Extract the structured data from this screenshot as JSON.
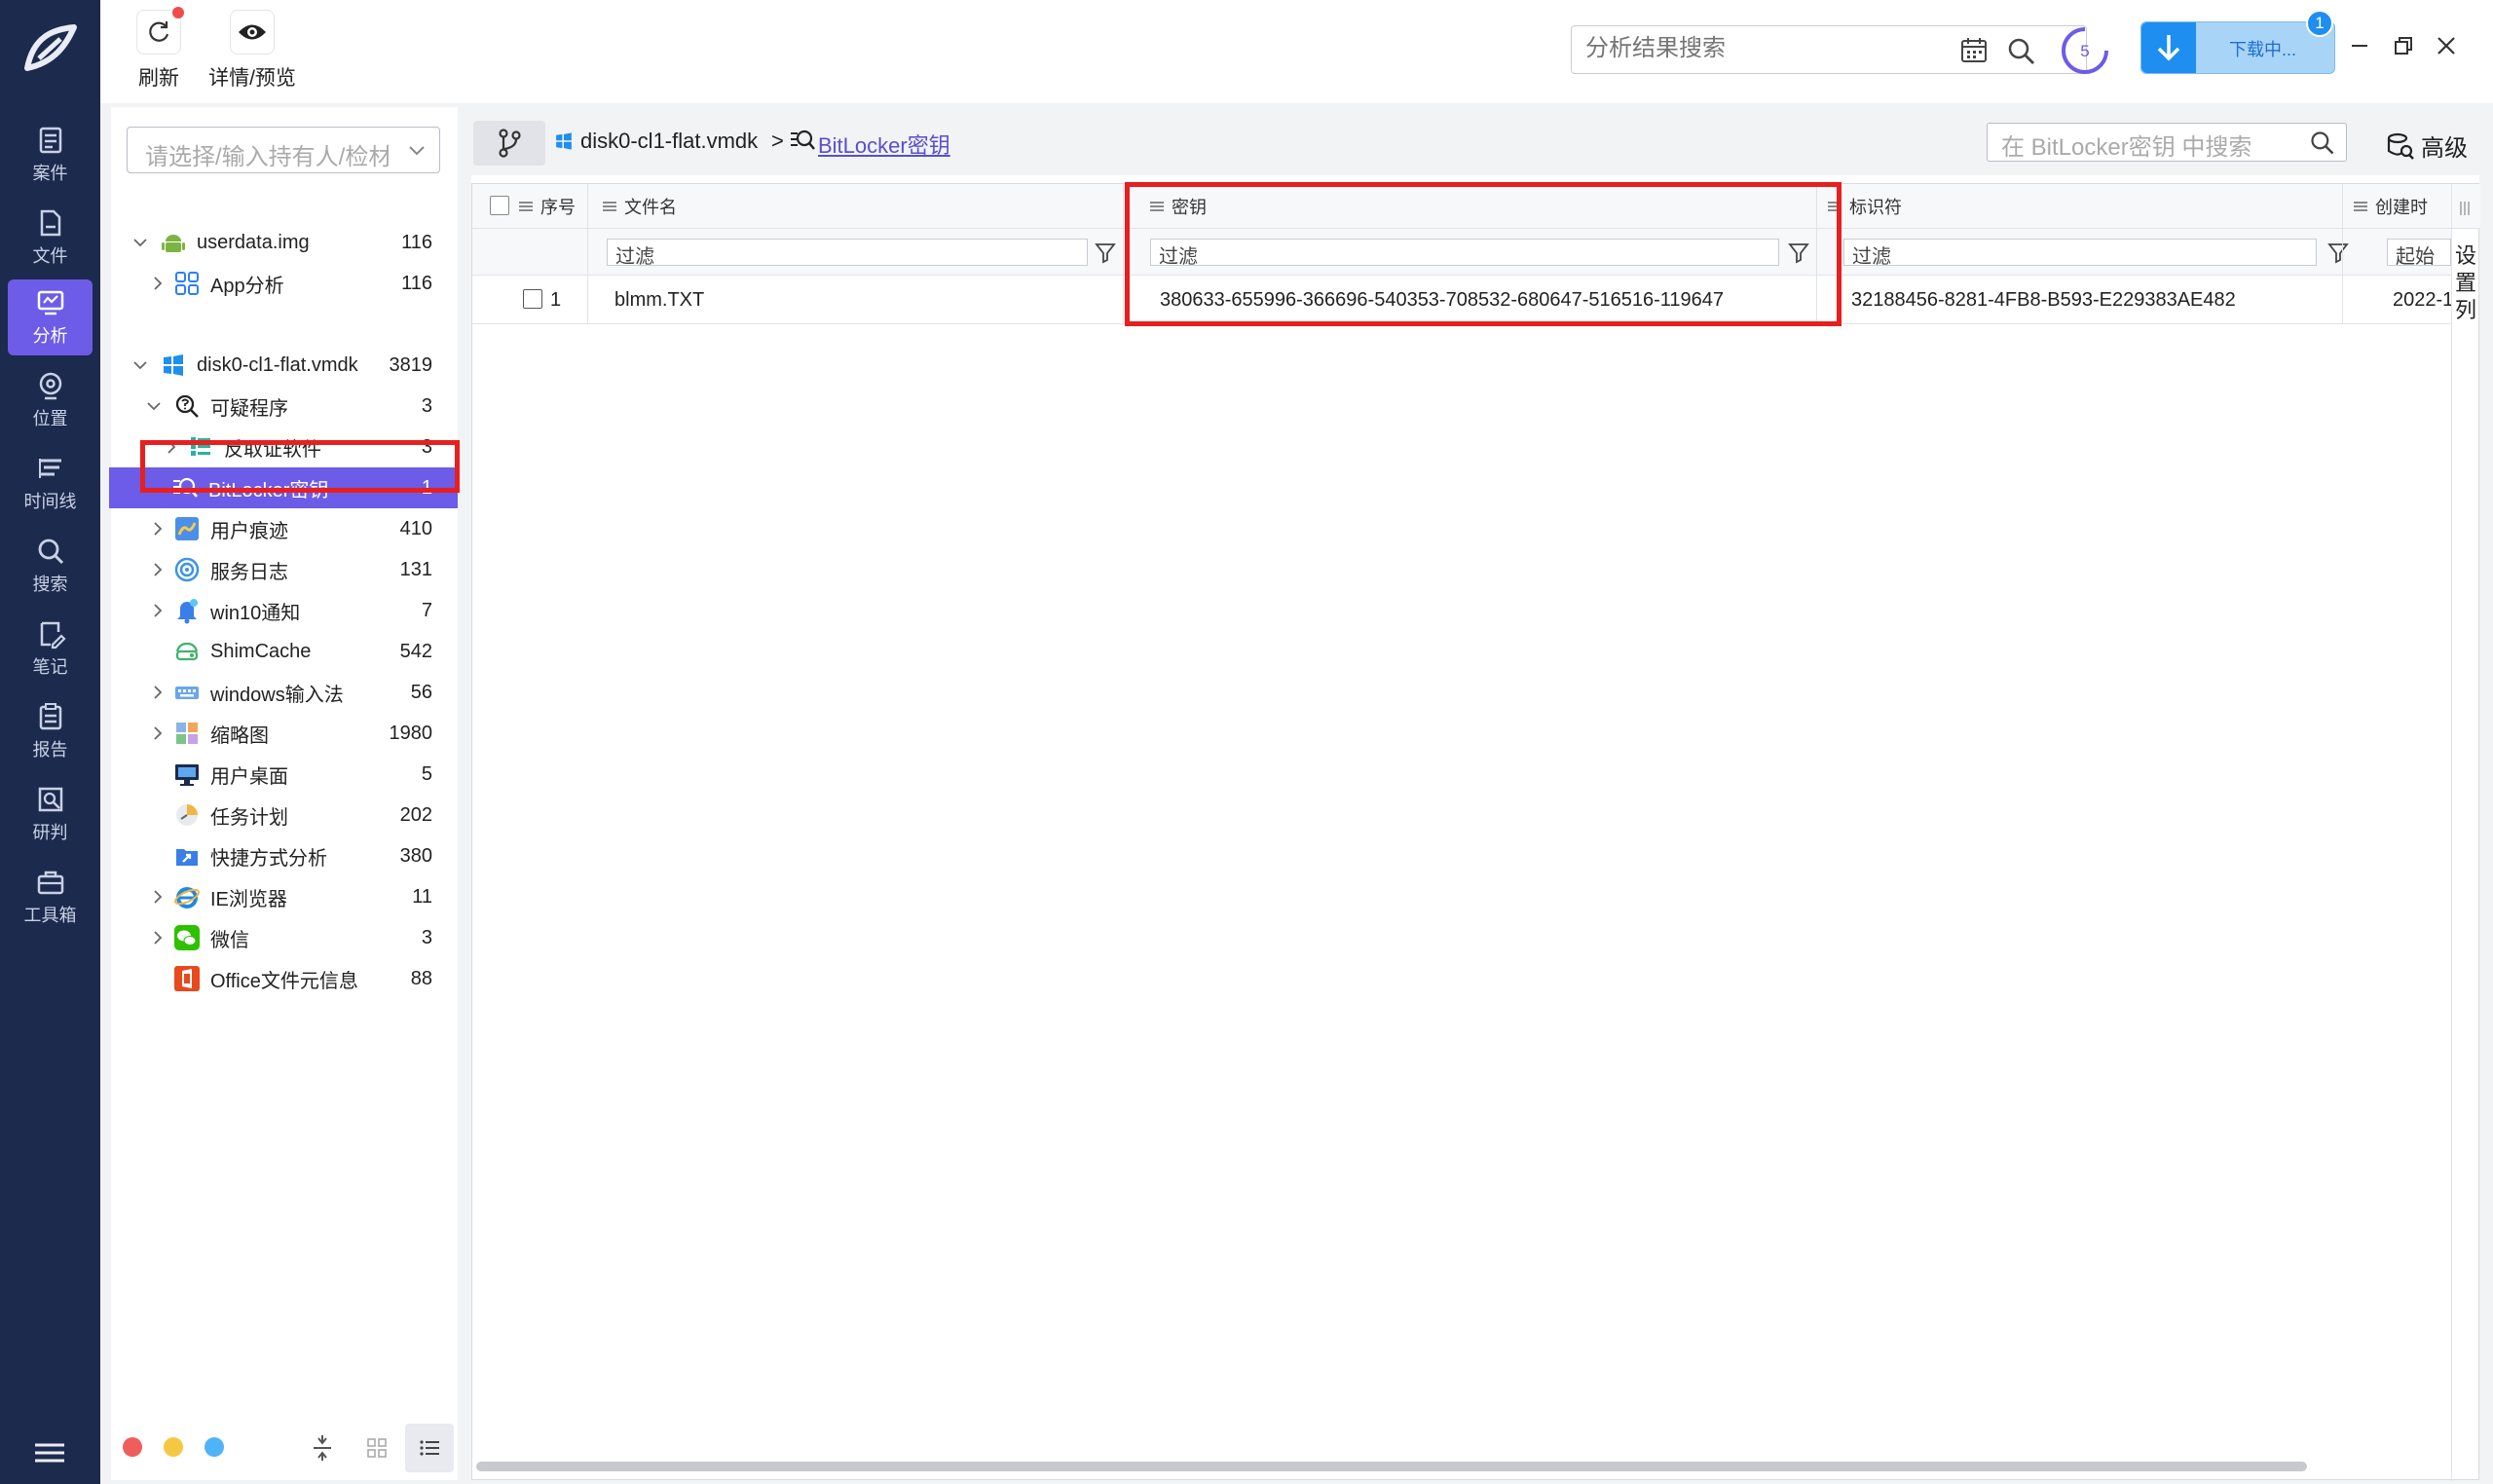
{
  "nav": {
    "items": [
      {
        "key": "case",
        "label": "案件",
        "icon": "case-icon"
      },
      {
        "key": "file",
        "label": "文件",
        "icon": "file-icon"
      },
      {
        "key": "analysis",
        "label": "分析",
        "icon": "analysis-icon",
        "active": true
      },
      {
        "key": "location",
        "label": "位置",
        "icon": "location-icon"
      },
      {
        "key": "timeline",
        "label": "时间线",
        "icon": "timeline-icon"
      },
      {
        "key": "search",
        "label": "搜索",
        "icon": "search-icon"
      },
      {
        "key": "notes",
        "label": "笔记",
        "icon": "notes-icon"
      },
      {
        "key": "report",
        "label": "报告",
        "icon": "report-icon"
      },
      {
        "key": "judge",
        "label": "研判",
        "icon": "judge-icon"
      },
      {
        "key": "toolbox",
        "label": "工具箱",
        "icon": "toolbox-icon"
      }
    ]
  },
  "toolbar": {
    "refresh_label": "刷新",
    "preview_label": "详情/预览",
    "search_placeholder": "分析结果搜索",
    "task_count": "5",
    "download_label": "下载中...",
    "download_badge": "1"
  },
  "tree": {
    "holder_placeholder": "请选择/输入持有人/检材",
    "nodes": [
      {
        "label": "userdata.img",
        "count": "116",
        "icon": "android-icon"
      },
      {
        "label": "App分析",
        "count": "116",
        "icon": "app-grid-icon"
      },
      {
        "label": "disk0-cl1-flat.vmdk",
        "count": "3819",
        "icon": "windows-icon"
      },
      {
        "label": "可疑程序",
        "count": "3",
        "icon": "suspicious-search-icon"
      },
      {
        "label": "反取证软件",
        "count": "3",
        "icon": "anti-forensics-icon"
      },
      {
        "label": "BitLocker密钥",
        "count": "1",
        "icon": "bitlocker-key-icon"
      },
      {
        "label": "用户痕迹",
        "count": "410",
        "icon": "user-trace-icon"
      },
      {
        "label": "服务日志",
        "count": "131",
        "icon": "service-log-icon"
      },
      {
        "label": "win10通知",
        "count": "7",
        "icon": "notification-bell-icon"
      },
      {
        "label": "ShimCache",
        "count": "542",
        "icon": "shimcache-icon"
      },
      {
        "label": "windows输入法",
        "count": "56",
        "icon": "keyboard-icon"
      },
      {
        "label": "缩略图",
        "count": "1980",
        "icon": "thumbnail-icon"
      },
      {
        "label": "用户桌面",
        "count": "5",
        "icon": "desktop-icon"
      },
      {
        "label": "任务计划",
        "count": "202",
        "icon": "task-schedule-icon"
      },
      {
        "label": "快捷方式分析",
        "count": "380",
        "icon": "shortcut-icon"
      },
      {
        "label": "IE浏览器",
        "count": "11",
        "icon": "ie-browser-icon"
      },
      {
        "label": "微信",
        "count": "3",
        "icon": "wechat-icon"
      },
      {
        "label": "Office文件元信息",
        "count": "88",
        "icon": "office-icon"
      }
    ]
  },
  "breadcrumb": {
    "parent": "disk0-cl1-flat.vmdk",
    "separator": ">",
    "current": "BitLocker密钥"
  },
  "content_search": {
    "placeholder": "在 BitLocker密钥 中搜索",
    "advanced_label": "高级"
  },
  "table": {
    "columns": {
      "index": "序号",
      "filename": "文件名",
      "key": "密钥",
      "identifier": "标识符",
      "created": "创建时"
    },
    "filter_placeholder": "过滤",
    "created_filter": "起始",
    "column_settings": "设置列",
    "rows": [
      {
        "index": "1",
        "filename": "blmm.TXT",
        "key": "380633-655996-366696-540353-708532-680647-516516-119647",
        "identifier": "32188456-8281-4FB8-B593-E229383AE482",
        "created": "2022-1"
      }
    ]
  },
  "colors": {
    "nav_bg": "#1c2a4d",
    "accent": "#6c5ce7",
    "highlight": "#e81f1f",
    "download_blue": "#1e8ef0"
  }
}
